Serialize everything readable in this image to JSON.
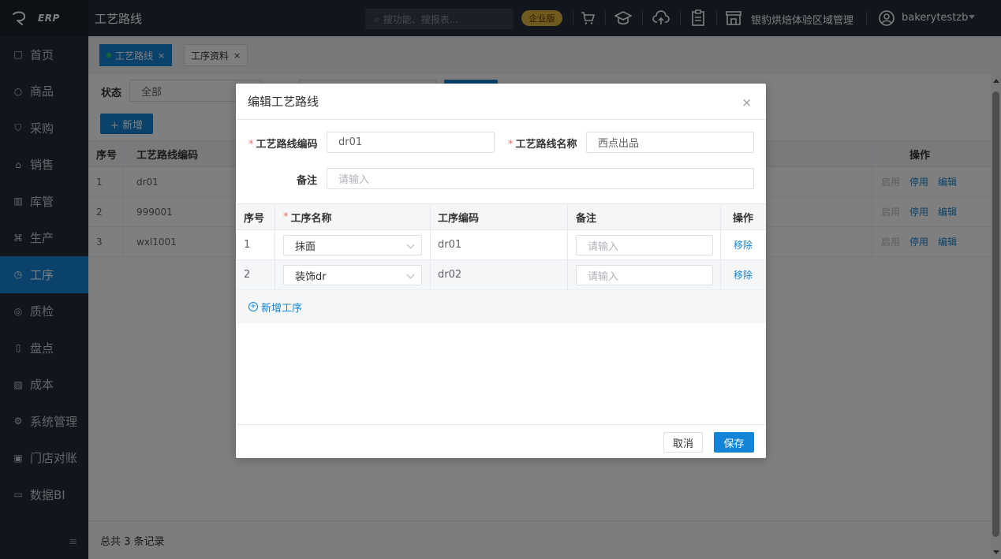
{
  "app": {
    "logo_text": "ERP",
    "page_title": "工艺路线"
  },
  "colors": {
    "primary": "#1485d6",
    "sidebar_bg": "#222b38",
    "badge_gold": "#e2b43a",
    "required": "#f56c6c"
  },
  "header": {
    "search_placeholder": "搜功能、搜报表...",
    "edition_badge": "企业版",
    "store_name": "银豹烘焙体验区域管理",
    "user_name": "bakerytestzb",
    "icons": [
      "cart-icon",
      "graduation-cap-icon",
      "cloud-upload-icon",
      "clipboard-icon",
      "store-icon",
      "user-circle-icon"
    ]
  },
  "sidebar": {
    "items": [
      {
        "label": "首页",
        "icon": "□"
      },
      {
        "label": "商品",
        "icon": "○"
      },
      {
        "label": "采购",
        "icon": "⛉"
      },
      {
        "label": "销售",
        "icon": "⌂"
      },
      {
        "label": "库管",
        "icon": "▥"
      },
      {
        "label": "生产",
        "icon": "⌘"
      },
      {
        "label": "工序",
        "icon": "◷"
      },
      {
        "label": "质检",
        "icon": "◎"
      },
      {
        "label": "盘点",
        "icon": "▯"
      },
      {
        "label": "成本",
        "icon": "▨"
      },
      {
        "label": "系统管理",
        "icon": "⚙"
      },
      {
        "label": "门店对账",
        "icon": "▣"
      },
      {
        "label": "数据BI",
        "icon": "▭"
      }
    ],
    "active_index": 6,
    "collapse_icon": "≡"
  },
  "tabs": [
    {
      "label": "工艺路线",
      "close": "×"
    },
    {
      "label": "工序资料",
      "close": "×"
    }
  ],
  "filter": {
    "status_label": "状态",
    "status_value": "全部"
  },
  "toolbar": {
    "add_label": "+ 新增"
  },
  "grid": {
    "headers": {
      "no": "序号",
      "code": "工艺路线编码",
      "actions": "操作"
    },
    "rows": [
      {
        "no": "1",
        "code": "dr01"
      },
      {
        "no": "2",
        "code": "999001"
      },
      {
        "no": "3",
        "code": "wxl1001"
      }
    ],
    "actions": {
      "enable": "启用",
      "disable": "停用",
      "edit": "编辑"
    }
  },
  "footer": {
    "total_text": "总共 3 条记录"
  },
  "dialog": {
    "title": "编辑工艺路线",
    "close": "×",
    "form": {
      "code_label": "工艺路线编码",
      "code_value": "dr01",
      "name_label": "工艺路线名称",
      "name_value": "西点出品",
      "remark_label": "备注",
      "remark_placeholder": "请输入",
      "required_mark": "*"
    },
    "table": {
      "headers": {
        "no": "序号",
        "name": "工序名称",
        "code": "工序编码",
        "remark": "备注",
        "actions": "操作"
      },
      "rows": [
        {
          "no": "1",
          "name": "抹面",
          "code": "dr01",
          "remark_placeholder": "请输入",
          "action": "移除"
        },
        {
          "no": "2",
          "name": "装饰dr",
          "code": "dr02",
          "remark_placeholder": "请输入",
          "action": "移除"
        }
      ]
    },
    "add_step_label": "新增工序",
    "add_step_icon": "+",
    "cancel_label": "取消",
    "save_label": "保存"
  }
}
